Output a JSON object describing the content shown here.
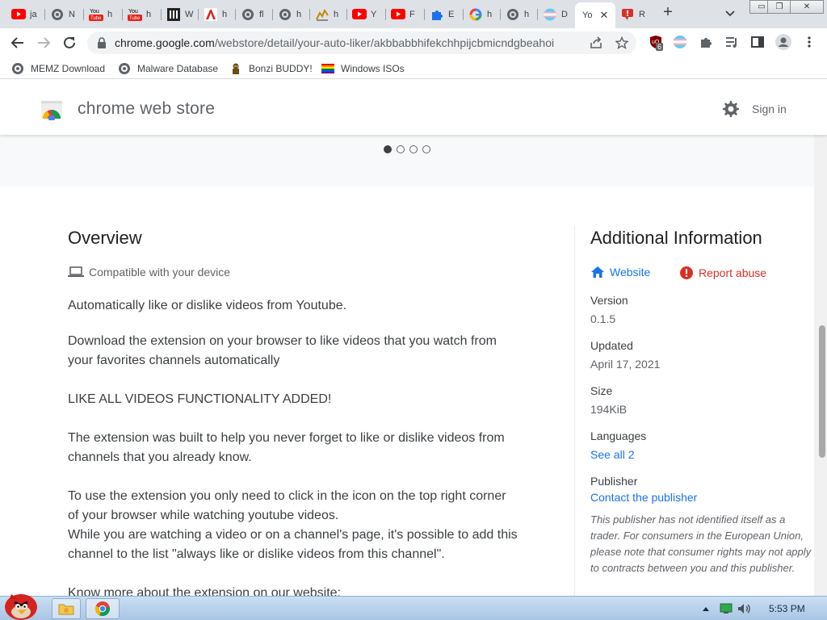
{
  "browser": {
    "tabs": [
      {
        "label": "ja",
        "icon": "youtube-icon"
      },
      {
        "label": "N",
        "icon": "globe-icon"
      },
      {
        "label": "h",
        "icon": "youtube-logo-icon"
      },
      {
        "label": "h",
        "icon": "youtube-logo-icon"
      },
      {
        "label": "W",
        "icon": "wikipedia-icon"
      },
      {
        "label": "h",
        "icon": "adobe-icon"
      },
      {
        "label": "fl",
        "icon": "globe-icon"
      },
      {
        "label": "h",
        "icon": "globe-icon"
      },
      {
        "label": "h",
        "icon": "sparkline-icon"
      },
      {
        "label": "Y",
        "icon": "youtube-icon"
      },
      {
        "label": "F",
        "icon": "youtube-icon"
      },
      {
        "label": "E",
        "icon": "puzzle-icon"
      },
      {
        "label": "h",
        "icon": "google-icon"
      },
      {
        "label": "h",
        "icon": "globe-icon"
      },
      {
        "label": "D",
        "icon": "flag-icon"
      },
      {
        "label": "Yo",
        "icon": "none",
        "active": true
      },
      {
        "label": "R",
        "icon": "thumbs-down-icon"
      }
    ],
    "new_tab_label": "+",
    "window_controls": {
      "minimize": "▭",
      "maximize": "❐",
      "close": "✕"
    },
    "url_domain": "chrome.google.com",
    "url_path": "/webstore/detail/your-auto-liker/akbbabbhifekchhpijcbmicndgbeahoi",
    "ublock_count": "6",
    "bookmarks": [
      {
        "label": "MEMZ Download",
        "icon": "globe-icon"
      },
      {
        "label": "Malware Database",
        "icon": "globe-icon"
      },
      {
        "label": "Bonzi BUDDY!",
        "icon": "bonzi-icon"
      },
      {
        "label": "Windows ISOs",
        "icon": "rainbow-flag-icon"
      }
    ]
  },
  "store": {
    "title": "chrome web store",
    "sign_in": "Sign in"
  },
  "overview": {
    "title": "Overview",
    "compat": "Compatible with your device",
    "paragraphs": [
      "Automatically like or dislike videos from Youtube.",
      "Download the extension on your browser to like videos that you watch from your favorites channels automatically",
      "LIKE ALL VIDEOS FUNCTIONALITY ADDED!",
      "The extension was built to help you never forget to like or dislike videos from channels that you already know.",
      "To use the extension you only need to click in the icon on the top right corner of your browser while watching youtube videos.",
      "While you are watching a video or on a channel's page, it's possible to add this channel to the list \"always like or dislike videos from this channel\".",
      "Know more about the extension on our website:"
    ]
  },
  "additional": {
    "title": "Additional Information",
    "website": "Website",
    "report": "Report abuse",
    "version_label": "Version",
    "version": "0.1.5",
    "updated_label": "Updated",
    "updated": "April 17, 2021",
    "size_label": "Size",
    "size": "194KiB",
    "languages_label": "Languages",
    "languages": "See all 2",
    "publisher_label": "Publisher",
    "publisher": "Contact the publisher",
    "trader_note": "This publisher has not identified itself as a trader. For consumers in the European Union, please note that consumer rights may not apply to contracts between you and this publisher."
  },
  "taskbar": {
    "clock": "5:53 PM"
  },
  "colors": {
    "link_blue": "#1a73e8",
    "report_red": "#d93025",
    "tabstrip": "#dee1e6"
  }
}
